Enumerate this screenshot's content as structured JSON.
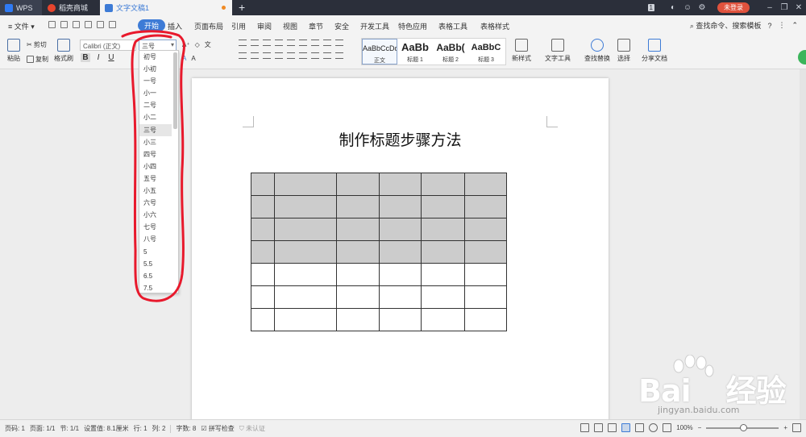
{
  "tabs": {
    "wps": "WPS",
    "shop": "稻壳商城",
    "document": "文字文稿1",
    "add": "+"
  },
  "titlebar": {
    "badge": "1",
    "login": "未登录",
    "min": "–",
    "max": "❐",
    "close": "✕"
  },
  "menubar": {
    "file": "≡ 文件 ▾",
    "items": [
      "开始",
      "插入",
      "页面布局",
      "引用",
      "审阅",
      "视图",
      "章节",
      "安全",
      "开发工具",
      "特色应用",
      "表格工具",
      "表格样式"
    ],
    "search": "查找命令、搜索模板",
    "help": "?"
  },
  "ribbon": {
    "paste": "粘贴",
    "cut": "剪切",
    "copy": "复制",
    "format_painter": "格式刷",
    "font_name": "Calibri (正文)",
    "font_size": "三号",
    "bold": "B",
    "italic": "I",
    "underline": "U",
    "styles": [
      {
        "sample": "AaBbCcDd",
        "name": "正文"
      },
      {
        "sample": "AaBb",
        "name": "标题 1"
      },
      {
        "sample": "AaBb(",
        "name": "标题 2"
      },
      {
        "sample": "AaBbC",
        "name": "标题 3"
      }
    ],
    "new_style": "新样式",
    "text_tools": "文字工具",
    "find_replace": "查找替换",
    "select": "选择",
    "share": "分享文档"
  },
  "font_size_dropdown": {
    "selected": "三号",
    "options": [
      "初号",
      "小初",
      "一号",
      "小一",
      "二号",
      "小二",
      "三号",
      "小三",
      "四号",
      "小四",
      "五号",
      "小五",
      "六号",
      "小六",
      "七号",
      "八号",
      "5",
      "5.5",
      "6.5",
      "7.5"
    ]
  },
  "document": {
    "title": "制作标题步骤方法",
    "table_rows": 7,
    "table_cols": 6,
    "shaded_rows": 4
  },
  "statusbar": {
    "page_num": "页码: 1",
    "pages": "页面: 1/1",
    "section": "节: 1/1",
    "setting": "设置值: 8.1厘米",
    "row": "行: 1",
    "col": "列: 2",
    "words": "字数: 8",
    "spellcheck": "拼写检查",
    "auth": "未认证",
    "zoom": "100%"
  },
  "watermark": {
    "brand": "Bai",
    "brand2": "经验",
    "url": "jingyan.baidu.com"
  },
  "colors": {
    "accent": "#3d7bd6",
    "highlight_red": "#e8192c",
    "table_shade": "#cccccc",
    "login_button": "#e0523d"
  }
}
